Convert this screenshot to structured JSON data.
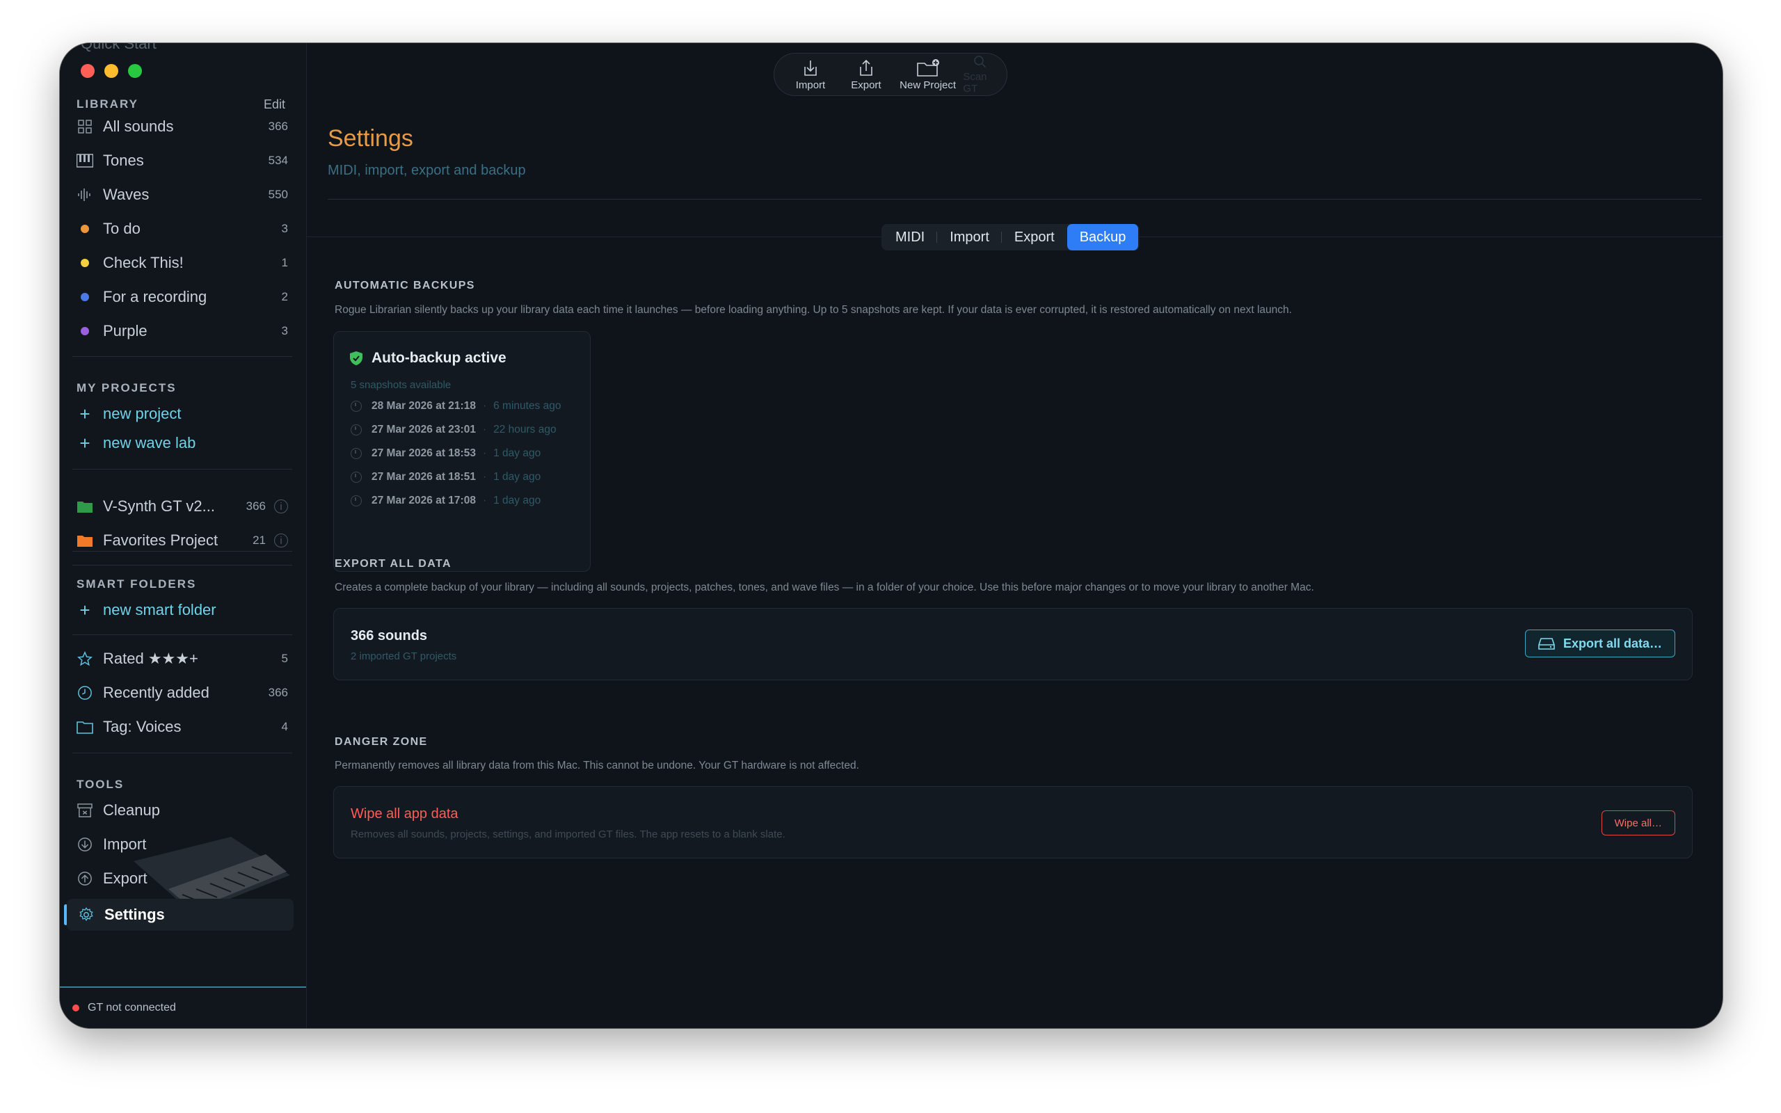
{
  "sidebar": {
    "ghost_top_label": "Quick Start",
    "library_header": "LIBRARY",
    "edit_label": "Edit",
    "library_items": [
      {
        "label": "All sounds",
        "count": "366",
        "icon": "grid-icon"
      },
      {
        "label": "Tones",
        "count": "534",
        "icon": "piano-keys-icon"
      },
      {
        "label": "Waves",
        "count": "550",
        "icon": "waveform-icon"
      },
      {
        "label": "To do",
        "count": "3",
        "color": "#f0963a"
      },
      {
        "label": "Check This!",
        "count": "1",
        "color": "#f5cf3f"
      },
      {
        "label": "For a recording",
        "count": "2",
        "color": "#4b7be8"
      },
      {
        "label": "Purple",
        "count": "3",
        "color": "#9b5fe0"
      }
    ],
    "projects_header": "MY PROJECTS",
    "project_links": [
      {
        "label": "new project"
      },
      {
        "label": "new wave lab"
      }
    ],
    "projects": [
      {
        "label": "V-Synth GT v2...",
        "count": "366",
        "color": "#2f9a4a"
      },
      {
        "label": "Favorites Project",
        "count": "21",
        "color": "#f07a2a"
      }
    ],
    "smart_header": "SMART FOLDERS",
    "smart_link": "new smart folder",
    "smart_items": [
      {
        "label": "Rated ★★★+",
        "count": "5",
        "icon": "star-icon"
      },
      {
        "label": "Recently added",
        "count": "366",
        "icon": "clock-icon"
      },
      {
        "label": "Tag: Voices",
        "count": "4",
        "icon": "folder-icon"
      }
    ],
    "tools_header": "TOOLS",
    "tools": [
      {
        "label": "Cleanup",
        "icon": "archive-icon"
      },
      {
        "label": "Import",
        "icon": "import-circle-icon"
      },
      {
        "label": "Export",
        "icon": "export-circle-icon"
      },
      {
        "label": "Settings",
        "icon": "gear-icon",
        "active": true
      }
    ],
    "status": "GT not connected"
  },
  "toolbar": {
    "import_label": "Import",
    "export_label": "Export",
    "new_project_label": "New Project",
    "scan_label": "Scan GT"
  },
  "main": {
    "title": "Settings",
    "subtitle": "MIDI, import, export and backup",
    "tabs": [
      "MIDI",
      "Import",
      "Export",
      "Backup"
    ],
    "active_tab": "Backup",
    "auto_backups": {
      "heading": "AUTOMATIC BACKUPS",
      "description": "Rogue Librarian silently backs up your library data each time it launches — before loading anything. Up to 5 snapshots are kept. If your data is ever corrupted, it is restored automatically on next launch.",
      "status": "Auto-backup active",
      "count_text": "5 snapshots available",
      "snapshots": [
        {
          "date": "28 Mar 2026 at 21:18",
          "ago": "6 minutes ago"
        },
        {
          "date": "27 Mar 2026 at 23:01",
          "ago": "22 hours ago"
        },
        {
          "date": "27 Mar 2026 at 18:53",
          "ago": "1 day ago"
        },
        {
          "date": "27 Mar 2026 at 18:51",
          "ago": "1 day ago"
        },
        {
          "date": "27 Mar 2026 at 17:08",
          "ago": "1 day ago"
        }
      ]
    },
    "export_all": {
      "heading": "EXPORT ALL DATA",
      "description": "Creates a complete backup of your library — including all sounds, projects, patches, tones, and wave files — in a folder of your choice. Use this before major changes or to move your library to another Mac.",
      "title": "366 sounds",
      "subtitle": "2 imported GT projects",
      "button": "Export all data…"
    },
    "danger": {
      "heading": "DANGER ZONE",
      "description": "Permanently removes all library data from this Mac. This cannot be undone. Your GT hardware is not affected.",
      "title": "Wipe all app data",
      "subtitle": "Removes all sounds, projects, settings, and imported GT files. The app resets to a blank slate.",
      "button": "Wipe all…"
    }
  },
  "colors": {
    "accent_orange": "#e89a45",
    "accent_cyan": "#6fd3e8",
    "tab_active": "#2e7cf6",
    "danger": "#ff5d55"
  }
}
